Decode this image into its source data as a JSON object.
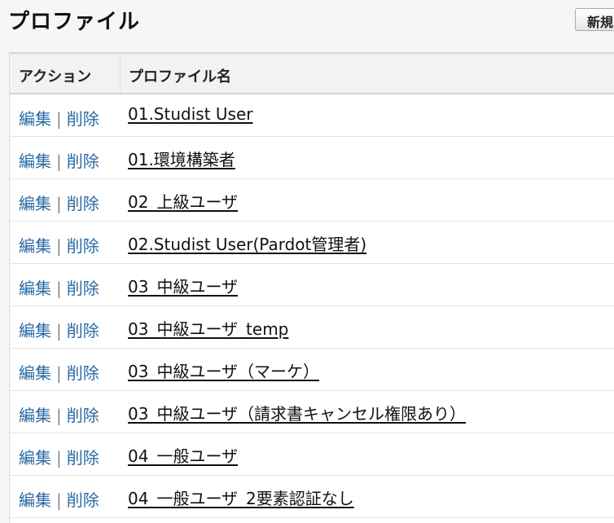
{
  "page": {
    "title": "プロファイル",
    "new_button_label": "新規"
  },
  "table": {
    "columns": {
      "action": "アクション",
      "name": "プロファイル名"
    },
    "action_labels": {
      "edit": "編集",
      "separator": "|",
      "delete": "削除"
    },
    "rows": [
      {
        "name": "01.Studist User"
      },
      {
        "name": "01.環境構築者"
      },
      {
        "name": "02_上級ユーザ"
      },
      {
        "name": "02.Studist User(Pardot管理者)"
      },
      {
        "name": "03_中級ユーザ"
      },
      {
        "name": "03_中級ユーザ_temp"
      },
      {
        "name": "03_中級ユーザ（マーケ）"
      },
      {
        "name": "03_中級ユーザ（請求書キャンセル権限あり）"
      },
      {
        "name": "04_一般ユーザ"
      },
      {
        "name": "04_一般ユーザ_2要素認証なし"
      }
    ]
  }
}
